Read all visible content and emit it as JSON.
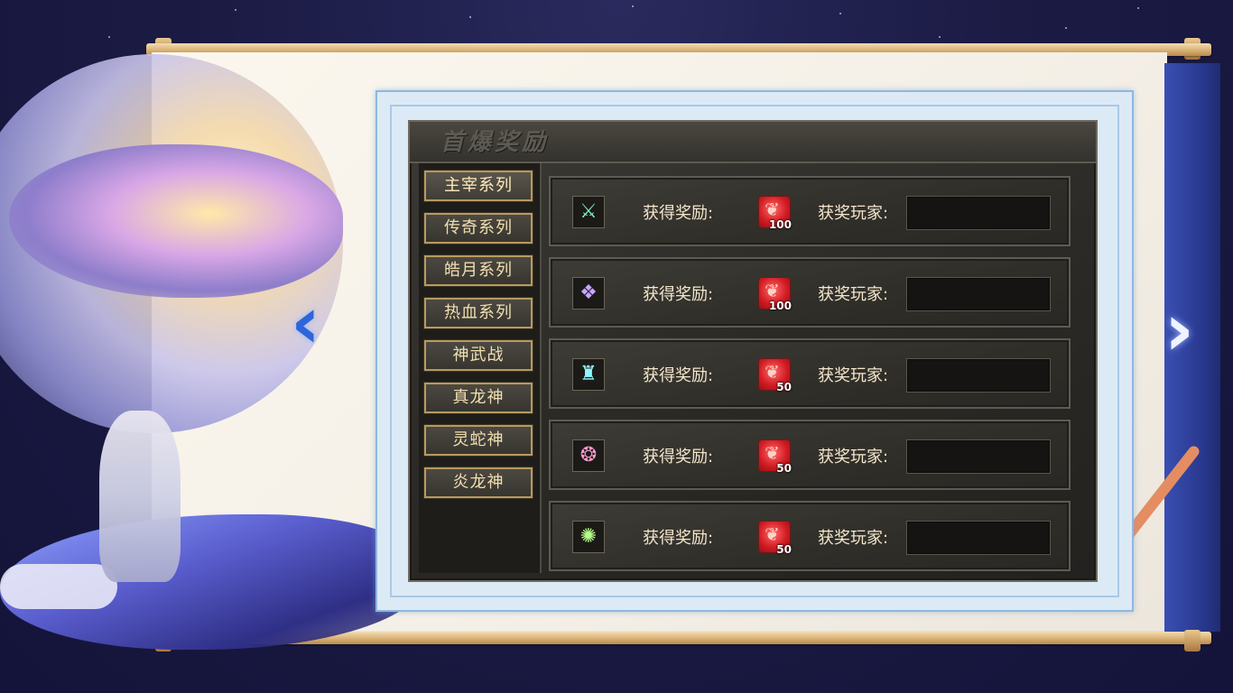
{
  "panel": {
    "title": "首爆奖励"
  },
  "tabs": [
    {
      "label": "主宰系列"
    },
    {
      "label": "传奇系列"
    },
    {
      "label": "皓月系列"
    },
    {
      "label": "热血系列"
    },
    {
      "label": "神武战"
    },
    {
      "label": "真龙神"
    },
    {
      "label": "灵蛇神"
    },
    {
      "label": "炎龙神"
    }
  ],
  "rows": [
    {
      "item_icon": "sword-icon",
      "reward_label": "获得奖励:",
      "reward_icon": "red-gem-icon",
      "reward_qty": "100",
      "player_label": "获奖玩家:",
      "player": ""
    },
    {
      "item_icon": "dragon-armor-icon",
      "reward_label": "获得奖励:",
      "reward_icon": "red-gem-icon",
      "reward_qty": "100",
      "player_label": "获奖玩家:",
      "player": ""
    },
    {
      "item_icon": "helmet-icon",
      "reward_label": "获得奖励:",
      "reward_icon": "red-gem-icon",
      "reward_qty": "50",
      "player_label": "获奖玩家:",
      "player": ""
    },
    {
      "item_icon": "necklace-icon",
      "reward_label": "获得奖励:",
      "reward_icon": "red-gem-icon",
      "reward_qty": "50",
      "player_label": "获奖玩家:",
      "player": ""
    },
    {
      "item_icon": "bracelet-icon",
      "reward_label": "获得奖励:",
      "reward_icon": "red-gem-icon",
      "reward_qty": "50",
      "player_label": "获奖玩家:",
      "player": ""
    }
  ],
  "nav": {
    "prev_glyph": "‹",
    "next_glyph": "›"
  },
  "colors": {
    "accent_gold": "#b89a5e",
    "panel_bg": "#2c2a26",
    "reward_red": "#d21c24",
    "ribbon_blue": "#2b3b92"
  }
}
